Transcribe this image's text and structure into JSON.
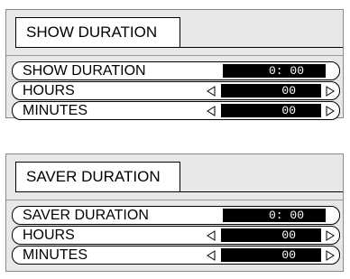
{
  "show_panel": {
    "title": "SHOW DURATION",
    "rows": [
      {
        "label": "SHOW DURATION",
        "value": "0: 00"
      },
      {
        "label": "HOURS",
        "value": "00"
      },
      {
        "label": "MINUTES",
        "value": "00"
      }
    ]
  },
  "saver_panel": {
    "title": "SAVER DURATION",
    "rows": [
      {
        "label": "SAVER DURATION",
        "value": "0: 00"
      },
      {
        "label": "HOURS",
        "value": "00"
      },
      {
        "label": "MINUTES",
        "value": "00"
      }
    ]
  },
  "icons": {
    "decrease": "triangle-left-outline-icon",
    "increase": "triangle-right-outline-icon"
  }
}
